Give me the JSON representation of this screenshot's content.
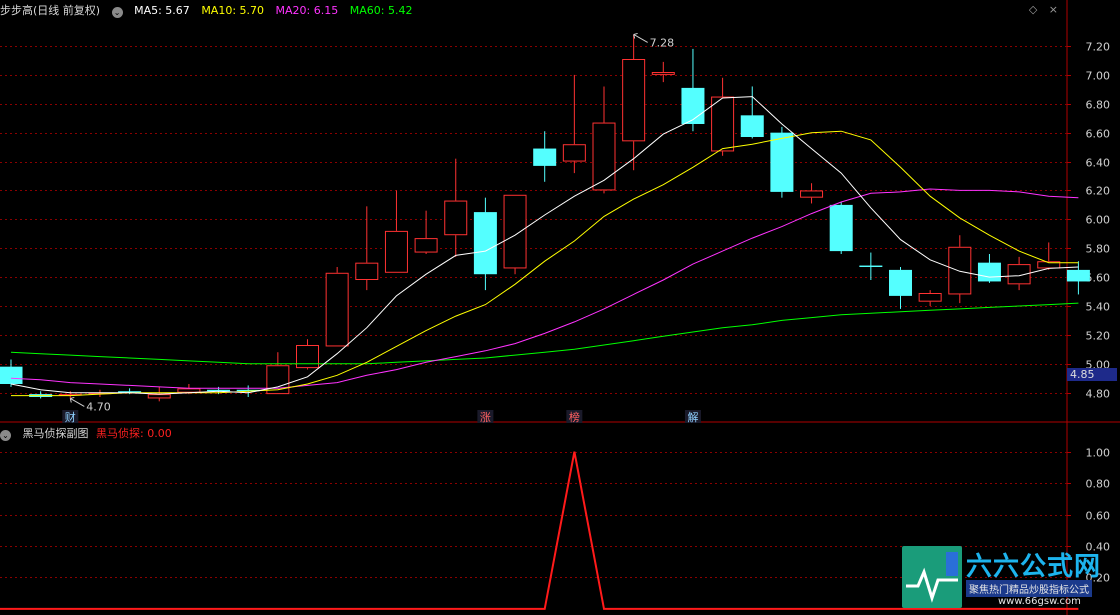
{
  "header": {
    "title": "步步高(日线 前复权)",
    "ma_labels": [
      {
        "text": "MA5: 5.67",
        "color": "#ffffff"
      },
      {
        "text": "MA10: 5.70",
        "color": "#ffff00"
      },
      {
        "text": "MA20: 6.15",
        "color": "#ff33ff"
      },
      {
        "text": "MA60: 5.42",
        "color": "#00ff00"
      }
    ]
  },
  "sub_header": {
    "title": "黑马侦探副图",
    "indicator": "黑马侦探: 0.00",
    "indicator_color": "#ff2020"
  },
  "top_icons": [
    "◇",
    "×"
  ],
  "current_price": "4.85",
  "logo": {
    "title": "六六公式网",
    "subtitle": "聚焦热门精品炒股指标公式",
    "url": "www.66gsw.com"
  },
  "colors": {
    "up": "#ff3232",
    "down": "#54ffff",
    "ma5": "#ffffff",
    "ma10": "#ffff00",
    "ma20": "#ff33ff",
    "ma60": "#00ff00",
    "grid": "#8a0000",
    "axis_text": "#d0d0d0"
  },
  "chart_data": [
    {
      "type": "candlestick",
      "yticks": [
        4.8,
        5.0,
        5.2,
        5.4,
        5.6,
        5.8,
        6.0,
        6.2,
        6.4,
        6.6,
        6.8,
        7.0,
        7.2
      ],
      "ylim": [
        4.68,
        7.38
      ],
      "candles": [
        {
          "o": 4.98,
          "h": 5.03,
          "l": 4.84,
          "c": 4.86
        },
        {
          "o": 4.79,
          "h": 4.81,
          "l": 4.76,
          "c": 4.77
        },
        {
          "o": 4.78,
          "h": 4.81,
          "l": 4.76,
          "c": 4.79
        },
        {
          "o": 4.79,
          "h": 4.82,
          "l": 4.77,
          "c": 4.8
        },
        {
          "o": 4.81,
          "h": 4.83,
          "l": 4.79,
          "c": 4.8
        },
        {
          "o": 4.76,
          "h": 4.84,
          "l": 4.74,
          "c": 4.79
        },
        {
          "o": 4.8,
          "h": 4.86,
          "l": 4.79,
          "c": 4.83
        },
        {
          "o": 4.82,
          "h": 4.84,
          "l": 4.79,
          "c": 4.81
        },
        {
          "o": 4.82,
          "h": 4.85,
          "l": 4.77,
          "c": 4.81
        },
        {
          "o": 4.79,
          "h": 5.08,
          "l": 4.79,
          "c": 4.99
        },
        {
          "o": 4.97,
          "h": 5.17,
          "l": 4.96,
          "c": 5.13
        },
        {
          "o": 5.12,
          "h": 5.67,
          "l": 5.12,
          "c": 5.63
        },
        {
          "o": 5.58,
          "h": 6.09,
          "l": 5.51,
          "c": 5.7
        },
        {
          "o": 5.63,
          "h": 6.2,
          "l": 5.63,
          "c": 5.92
        },
        {
          "o": 5.77,
          "h": 6.06,
          "l": 5.76,
          "c": 5.87
        },
        {
          "o": 5.89,
          "h": 6.42,
          "l": 5.74,
          "c": 6.13
        },
        {
          "o": 6.05,
          "h": 6.15,
          "l": 5.51,
          "c": 5.62
        },
        {
          "o": 5.66,
          "h": 6.17,
          "l": 5.62,
          "c": 6.17
        },
        {
          "o": 6.49,
          "h": 6.61,
          "l": 6.26,
          "c": 6.37
        },
        {
          "o": 6.4,
          "h": 7.0,
          "l": 6.32,
          "c": 6.52
        },
        {
          "o": 6.2,
          "h": 6.92,
          "l": 6.18,
          "c": 6.67
        },
        {
          "o": 6.54,
          "h": 7.28,
          "l": 6.34,
          "c": 7.11
        },
        {
          "o": 7.0,
          "h": 7.09,
          "l": 6.95,
          "c": 7.02
        },
        {
          "o": 6.91,
          "h": 7.18,
          "l": 6.61,
          "c": 6.66
        },
        {
          "o": 6.47,
          "h": 6.98,
          "l": 6.44,
          "c": 6.85
        },
        {
          "o": 6.72,
          "h": 6.92,
          "l": 6.56,
          "c": 6.57
        },
        {
          "o": 6.6,
          "h": 6.64,
          "l": 6.15,
          "c": 6.19
        },
        {
          "o": 6.15,
          "h": 6.25,
          "l": 6.11,
          "c": 6.2
        },
        {
          "o": 6.1,
          "h": 6.12,
          "l": 5.76,
          "c": 5.78
        },
        {
          "o": 5.68,
          "h": 5.77,
          "l": 5.58,
          "c": 5.67
        },
        {
          "o": 5.65,
          "h": 5.67,
          "l": 5.38,
          "c": 5.47
        },
        {
          "o": 5.43,
          "h": 5.51,
          "l": 5.4,
          "c": 5.49
        },
        {
          "o": 5.48,
          "h": 5.89,
          "l": 5.42,
          "c": 5.81
        },
        {
          "o": 5.7,
          "h": 5.76,
          "l": 5.56,
          "c": 5.57
        },
        {
          "o": 5.55,
          "h": 5.74,
          "l": 5.51,
          "c": 5.69
        },
        {
          "o": 5.66,
          "h": 5.84,
          "l": 5.65,
          "c": 5.71
        },
        {
          "o": 5.65,
          "h": 5.71,
          "l": 5.48,
          "c": 5.57
        }
      ],
      "ma": {
        "ma5": [
          4.86,
          4.82,
          4.8,
          4.8,
          4.8,
          4.79,
          4.8,
          4.81,
          4.8,
          4.84,
          4.91,
          5.07,
          5.25,
          5.47,
          5.62,
          5.75,
          5.78,
          5.89,
          6.03,
          6.16,
          6.27,
          6.42,
          6.59,
          6.69,
          6.84,
          6.85,
          6.66,
          6.49,
          6.32,
          6.08,
          5.86,
          5.72,
          5.64,
          5.6,
          5.61,
          5.66,
          5.67
        ],
        "ma10": [
          4.78,
          4.78,
          4.78,
          4.79,
          4.8,
          4.8,
          4.8,
          4.8,
          4.81,
          4.82,
          4.86,
          4.92,
          5.01,
          5.12,
          5.23,
          5.33,
          5.41,
          5.55,
          5.71,
          5.85,
          6.02,
          6.14,
          6.24,
          6.36,
          6.49,
          6.52,
          6.56,
          6.6,
          6.61,
          6.55,
          6.36,
          6.16,
          6.01,
          5.89,
          5.78,
          5.7,
          5.7
        ],
        "ma20": [
          4.9,
          4.89,
          4.87,
          4.86,
          4.85,
          4.84,
          4.83,
          4.83,
          4.83,
          4.83,
          4.85,
          4.87,
          4.92,
          4.96,
          5.01,
          5.05,
          5.09,
          5.14,
          5.21,
          5.29,
          5.38,
          5.48,
          5.58,
          5.69,
          5.78,
          5.87,
          5.95,
          6.04,
          6.12,
          6.18,
          6.19,
          6.21,
          6.2,
          6.2,
          6.19,
          6.16,
          6.15
        ],
        "ma60": [
          5.08,
          5.07,
          5.06,
          5.05,
          5.04,
          5.03,
          5.02,
          5.01,
          5.0,
          5.0,
          5.0,
          5.0,
          5.0,
          5.01,
          5.02,
          5.03,
          5.04,
          5.06,
          5.08,
          5.1,
          5.13,
          5.16,
          5.19,
          5.22,
          5.25,
          5.27,
          5.3,
          5.32,
          5.34,
          5.35,
          5.36,
          5.37,
          5.38,
          5.39,
          5.4,
          5.41,
          5.42
        ]
      },
      "annotations": [
        {
          "text": "7.28",
          "index": 21,
          "price": 7.28
        },
        {
          "text": "4.70",
          "index": 2,
          "price": 4.76
        }
      ],
      "markers": [
        {
          "text": "财",
          "index": 2
        },
        {
          "text": "涨",
          "index": 16
        },
        {
          "text": "榜",
          "index": 19
        },
        {
          "text": "解",
          "index": 23
        }
      ]
    },
    {
      "type": "line",
      "name": "黑马侦探",
      "yticks": [
        0.2,
        0.4,
        0.6,
        0.8,
        1.0
      ],
      "ylim": [
        -0.02,
        1.1
      ],
      "values": [
        0,
        0,
        0,
        0,
        0,
        0,
        0,
        0,
        0,
        0,
        0,
        0,
        0,
        0,
        0,
        0,
        0,
        0,
        0,
        1,
        0,
        0,
        0,
        0,
        0,
        0,
        0,
        0,
        0,
        0,
        0,
        0,
        0,
        0,
        0,
        0,
        0
      ]
    }
  ]
}
